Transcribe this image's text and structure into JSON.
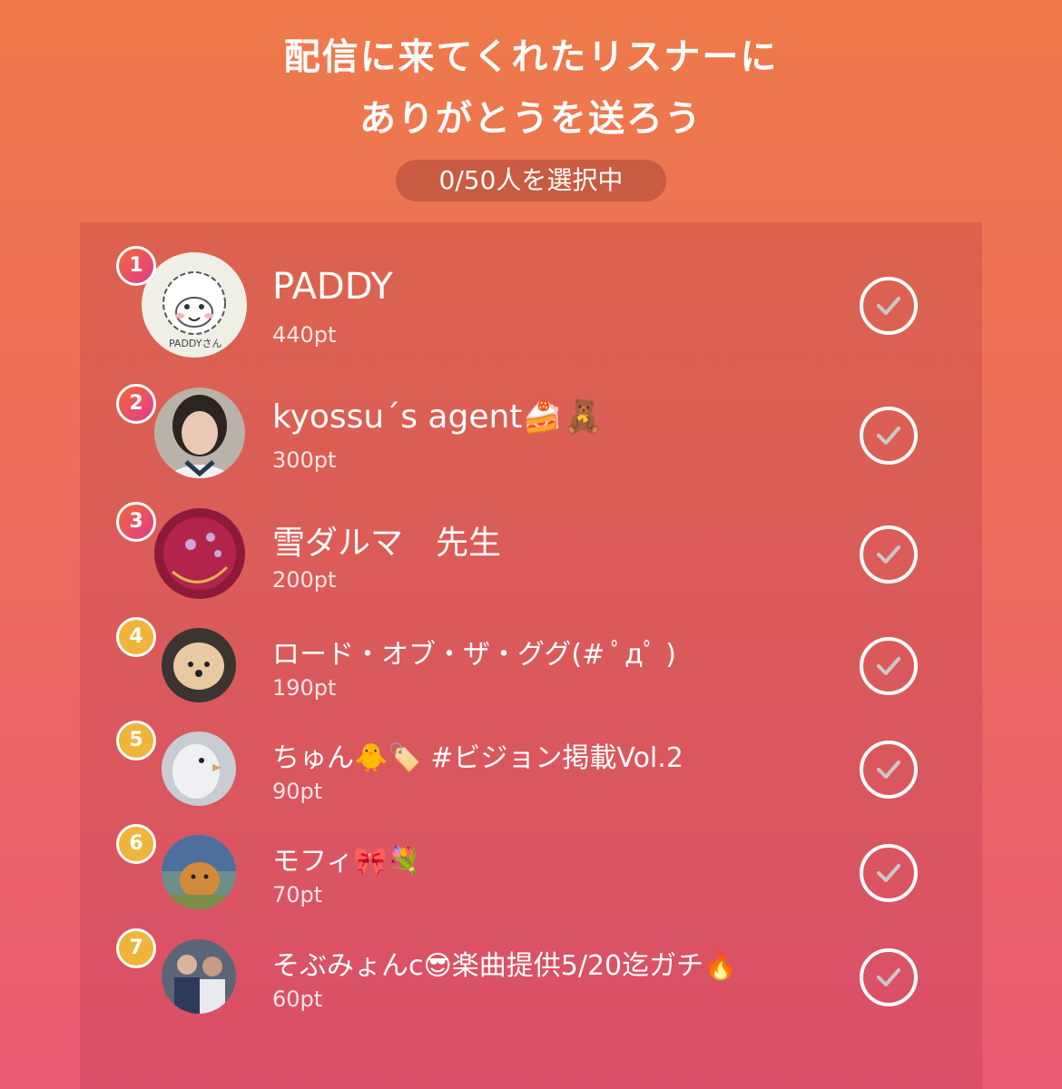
{
  "header": {
    "title_line1": "配信に来てくれたリスナーに",
    "title_line2": "ありがとうを送ろう",
    "selection_counter": "0/50人を選択中"
  },
  "colors": {
    "background_top": "#ee7a4a",
    "background_bottom": "#ea5a72",
    "rank_top3_gradient": [
      "#f06a3a",
      "#e23a8a"
    ],
    "rank_other": "#f0b43a",
    "check_ring": "#ffffff"
  },
  "listeners": [
    {
      "rank": "1",
      "name": "PADDY",
      "points": "440pt",
      "avatar": "alpaca-drawing-avatar",
      "selected": false
    },
    {
      "rank": "2",
      "name": "kyossu´s agent🍰🧸",
      "points": "300pt",
      "avatar": "person-avatar",
      "selected": false
    },
    {
      "rank": "3",
      "name": "雪ダルマ　先生",
      "points": "200pt",
      "avatar": "red-floral-avatar",
      "selected": false
    },
    {
      "rank": "4",
      "name": "ロード・オブ・ザ・ググ(# ﾟдﾟ )",
      "points": "190pt",
      "avatar": "pomeranian-avatar",
      "selected": false
    },
    {
      "rank": "5",
      "name": "ちゅん🐥🏷️ #ビジョン掲載Vol.2",
      "points": "90pt",
      "avatar": "bird-avatar",
      "selected": false
    },
    {
      "rank": "6",
      "name": "モフィ🎀💐",
      "points": "70pt",
      "avatar": "dog-painting-avatar",
      "selected": false
    },
    {
      "rank": "7",
      "name": "そぶみょんc😎楽曲提供5/20迄ガチ🔥",
      "points": "60pt",
      "avatar": "two-people-avatar",
      "selected": false
    }
  ]
}
